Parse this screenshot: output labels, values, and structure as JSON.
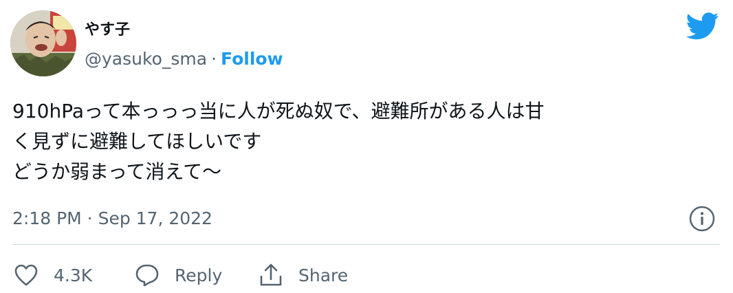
{
  "user": {
    "display_name": "やす子",
    "handle": "@yasuko_sma",
    "separator": "·",
    "follow_label": "Follow"
  },
  "tweet": {
    "lines": [
      "910hPaって本っっっ当に人が死ぬ奴で、避難所がある人は甘",
      "く見ずに避難してほしいです",
      "どうか弱まって消えて〜"
    ],
    "timestamp": "2:18 PM · Sep 17, 2022"
  },
  "actions": {
    "like_count": "4.3K",
    "reply_label": "Reply",
    "share_label": "Share"
  },
  "colors": {
    "accent": "#1d9bf0",
    "text": "#0f1419",
    "secondary": "#536471",
    "divider": "#cfd9de"
  },
  "icons": [
    "twitter-bird-icon",
    "info-icon",
    "heart-icon",
    "reply-bubble-icon",
    "share-icon"
  ]
}
